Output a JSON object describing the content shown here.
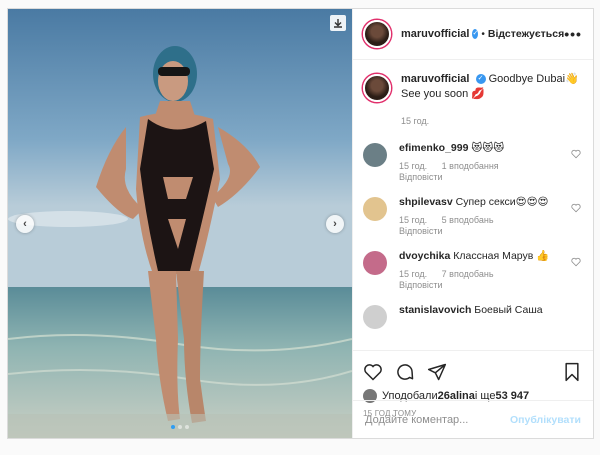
{
  "post": {
    "author": "maruvofficial",
    "follow_status": "Відстежується",
    "bullet": "•",
    "more": "•••",
    "caption_text": "Goodbye Dubai👋",
    "caption_line2": "See you soon 💋",
    "caption_time": "15 год.",
    "comments": [
      {
        "user": "efimenko_999",
        "text": "😻😻😻",
        "time": "15 год.",
        "likes": "1 вподобання",
        "reply": "Відповісти",
        "avatar_color": "#6b7f86"
      },
      {
        "user": "shpilevasv",
        "text": "Супер секси😍😍😍",
        "time": "15 год.",
        "likes": "5 вподобань",
        "reply": "Відповісти",
        "avatar_color": "#e2c48f"
      },
      {
        "user": "dvoychika",
        "text": "Классная Марув 👍",
        "time": "15 год.",
        "likes": "7 вподобань",
        "reply": "Відповісти",
        "avatar_color": "#c46b8a"
      },
      {
        "user": "stanislavovich",
        "text": "Боевый Саша",
        "time": "",
        "likes": "",
        "reply": "",
        "avatar_color": "#cfcfcf"
      }
    ],
    "likes_prefix": "Уподобали ",
    "likes_user": "26alina",
    "likes_mid": " і ще ",
    "likes_count": "53 947",
    "post_time": "15 ГОД ТОМУ",
    "add_comment_placeholder": "Додайте коментар...",
    "publish_label": "Опублікувати",
    "carousel_index": 1,
    "carousel_total": 3,
    "colors": {
      "accent": "#3897f0",
      "publish_disabled": "#b2dffc"
    }
  }
}
